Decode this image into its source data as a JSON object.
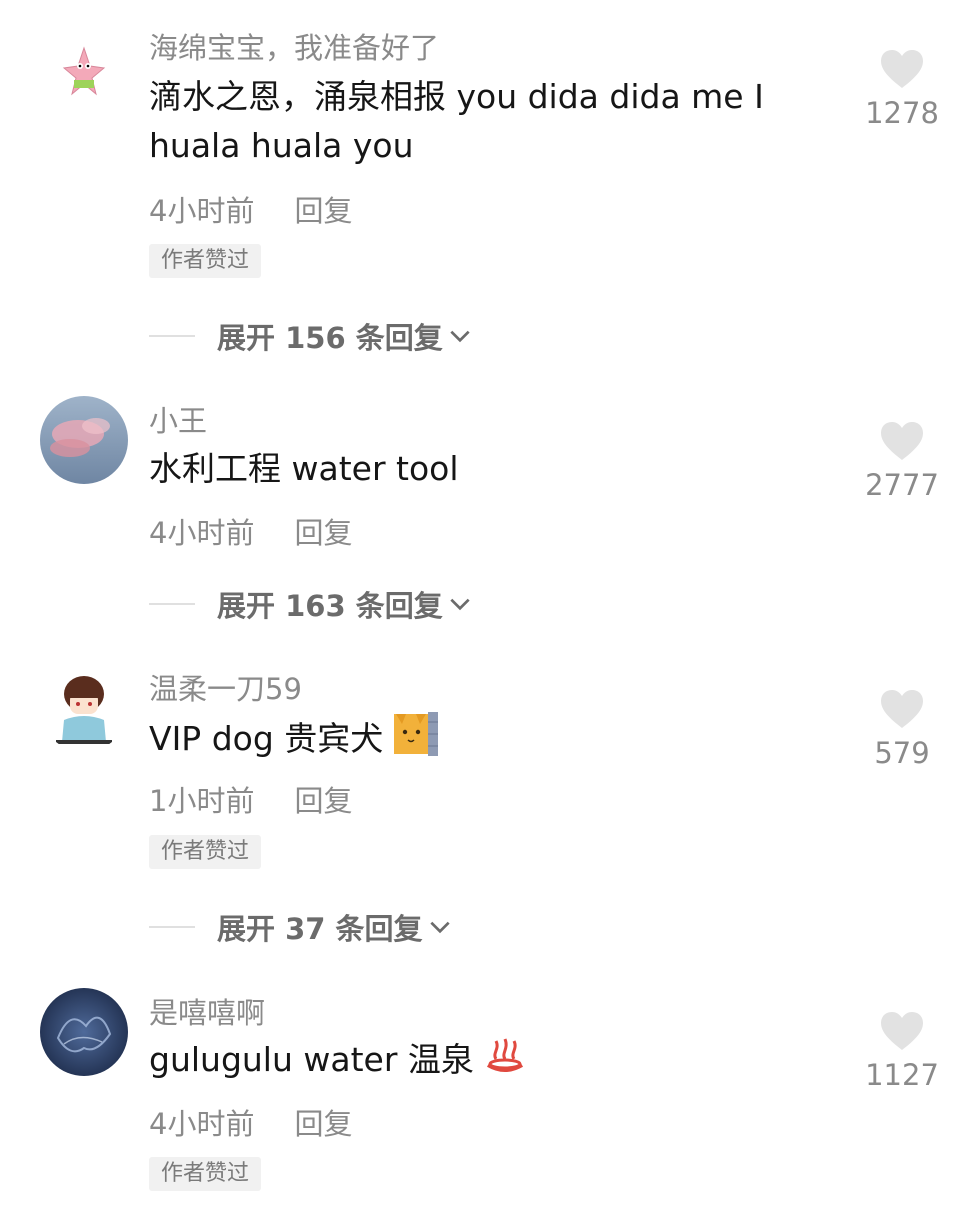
{
  "comments": [
    {
      "username": "海绵宝宝，我准备好了",
      "text": "滴水之恩，涌泉相报 you dida dida me I huala huala you",
      "time": "4小时前",
      "reply": "回复",
      "badge": "作者赞过",
      "expand": "展开 156 条回复",
      "likes": "1278",
      "avatar_icon": "patrick-star-avatar"
    },
    {
      "username": "小王",
      "text": "水利工程 water tool",
      "time": "4小时前",
      "reply": "回复",
      "badge": "",
      "expand": "展开 163 条回复",
      "likes": "2777",
      "avatar_icon": "pink-cloud-avatar"
    },
    {
      "username": "温柔一刀59",
      "text": "VIP dog 贵宾犬",
      "text_emoji": "cat-peek-emoji",
      "time": "1小时前",
      "reply": "回复",
      "badge": "作者赞过",
      "expand": "展开 37 条回复",
      "likes": "579",
      "avatar_icon": "cartoon-boy-avatar"
    },
    {
      "username": "是嘻嘻啊",
      "text": "gulugulu water 温泉",
      "text_emoji": "hot-springs-emoji",
      "time": "4小时前",
      "reply": "回复",
      "badge": "作者赞过",
      "likes": "1127",
      "avatar_icon": "dark-blue-avatar"
    }
  ],
  "colors": {
    "text_primary": "#161616",
    "text_secondary": "#8a8a8a",
    "heart": "#e2e2e2",
    "badge_bg": "#f1f1f1"
  }
}
